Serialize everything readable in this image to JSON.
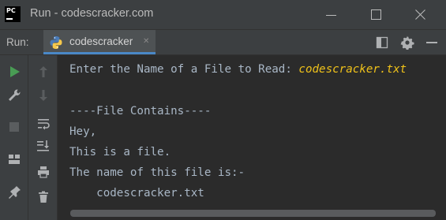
{
  "window": {
    "title": "Run - codescracker.com"
  },
  "toolbar": {
    "run_label": "Run:",
    "tab_label": "codescracker"
  },
  "console": {
    "prompt": "Enter the Name of a File to Read: ",
    "user_input": "codescracker.txt",
    "lines": [
      "----File Contains----",
      "Hey,",
      "This is a file.",
      "The name of this file is:-",
      "    codescracker.txt"
    ]
  },
  "colors": {
    "input": "#f0c21a",
    "run_green": "#499c54",
    "tab_underline": "#4a88c7"
  }
}
